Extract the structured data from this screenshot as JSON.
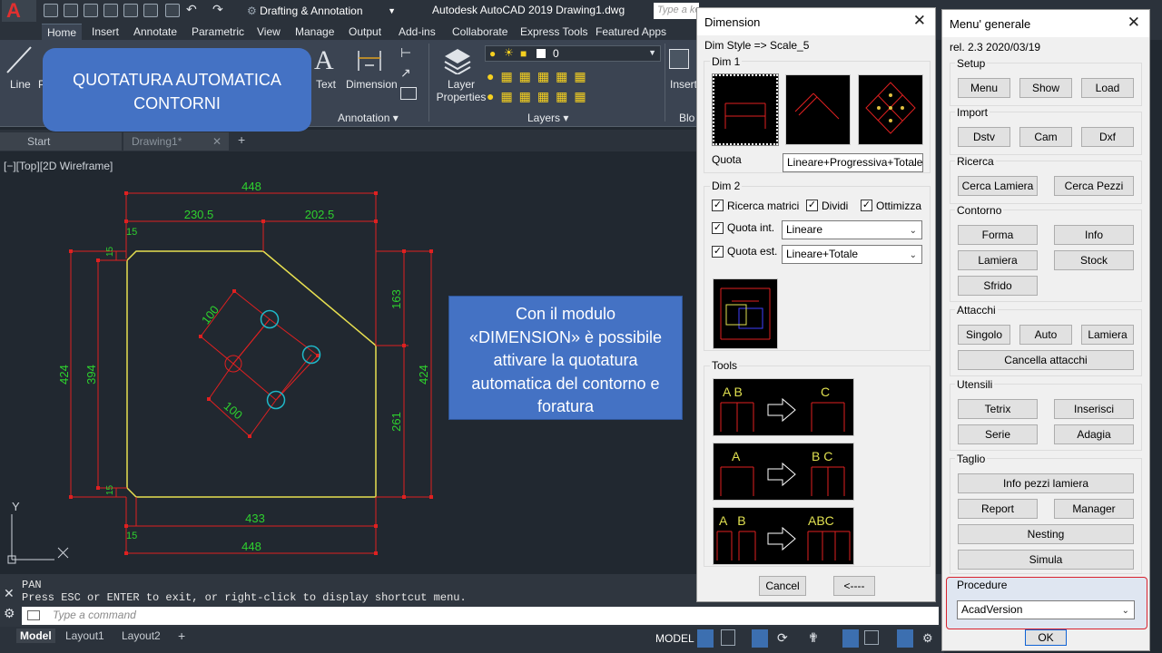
{
  "app": {
    "logo": "A",
    "workspace": "Drafting & Annotation",
    "title": "Autodesk AutoCAD 2019    Drawing1.dwg",
    "search_placeholder": "Type a keyword or phrase"
  },
  "ribbon": {
    "tabs": [
      "Home",
      "Insert",
      "Annotate",
      "Parametric",
      "View",
      "Manage",
      "Output",
      "Add-ins",
      "Collaborate",
      "Express Tools",
      "Featured Apps"
    ],
    "line_label": "Line",
    "p_label": "P",
    "text_label": "Text",
    "dimension_label": "Dimension",
    "annotation_panel": "Annotation ▾",
    "layer_properties": "Layer\nProperties",
    "layers_panel": "Layers ▾",
    "layer_value": "0",
    "insert_label": "Insert",
    "block_panel": "Blo"
  },
  "filetabs": {
    "start": "Start",
    "drawing": "Drawing1*",
    "close": "✕",
    "plus": "+"
  },
  "viewport": {
    "label": "[−][Top][2D Wireframe]",
    "ucs_y": "Y"
  },
  "drawing": {
    "dims": [
      "448",
      "230.5",
      "202.5",
      "15",
      "15",
      "163",
      "424",
      "394",
      "424",
      "261",
      "15",
      "100",
      "100",
      "433",
      "15",
      "448"
    ]
  },
  "overlays": {
    "box1_line1": "QUOTATURA AUTOMATICA",
    "box1_line2": "CONTORNI",
    "box2_lines": [
      "Con il modulo",
      "«DIMENSION» è possibile",
      "attivare la quotatura",
      "automatica del contorno e",
      "foratura"
    ]
  },
  "command": {
    "hist1": "PAN",
    "hist2": "Press ESC or ENTER to exit, or right-click to display shortcut menu.",
    "placeholder": "Type a command"
  },
  "status": {
    "model_tab": "Model",
    "layout1": "Layout1",
    "layout2": "Layout2",
    "model_label": "MODEL"
  },
  "dimension_dialog": {
    "title": "Dimension",
    "dim_style": "Dim Style => Scale_5",
    "dim1": "Dim 1",
    "quota_label": "Quota",
    "quota_value": "Lineare+Progressiva+Totale",
    "dim2": "Dim 2",
    "ricerca_matrici": "Ricerca matrici",
    "dividi": "Dividi",
    "ottimizza": "Ottimizza",
    "quota_int": "Quota int.",
    "quota_int_value": "Lineare",
    "quota_est": "Quota est.",
    "quota_est_value": "Lineare+Totale",
    "tools": "Tools",
    "tool1_left": "A B",
    "tool1_right": "C",
    "tool2_left": "A",
    "tool2_right": "B C",
    "tool3_left": "A   B",
    "tool3_right": "ABC",
    "cancel": "Cancel",
    "back": "<----"
  },
  "menu_dialog": {
    "title": "Menu' generale",
    "version": "rel. 2.3 2020/03/19",
    "setup": "Setup",
    "setup_buttons": [
      "Menu",
      "Show",
      "Load"
    ],
    "import": "Import",
    "import_buttons": [
      "Dstv",
      "Cam",
      "Dxf"
    ],
    "ricerca": "Ricerca",
    "ricerca_buttons": [
      "Cerca Lamiera",
      "Cerca Pezzi"
    ],
    "contorno": "Contorno",
    "contorno_buttons": [
      "Forma",
      "Info",
      "Lamiera",
      "Stock",
      "Sfrido"
    ],
    "attacchi": "Attacchi",
    "attacchi_buttons": [
      "Singolo",
      "Auto",
      "Lamiera",
      "Cancella attacchi"
    ],
    "utensili": "Utensili",
    "utensili_buttons": [
      "Tetrix",
      "Inserisci",
      "Serie",
      "Adagia"
    ],
    "taglio": "Taglio",
    "taglio_buttons": [
      "Info pezzi lamiera",
      "Report",
      "Manager",
      "Nesting",
      "Simula"
    ],
    "procedure": "Procedure",
    "procedure_value": "AcadVersion",
    "ok": "OK"
  },
  "colors": {
    "highlight": "#d9232e",
    "accent_blue": "#4472c4"
  }
}
